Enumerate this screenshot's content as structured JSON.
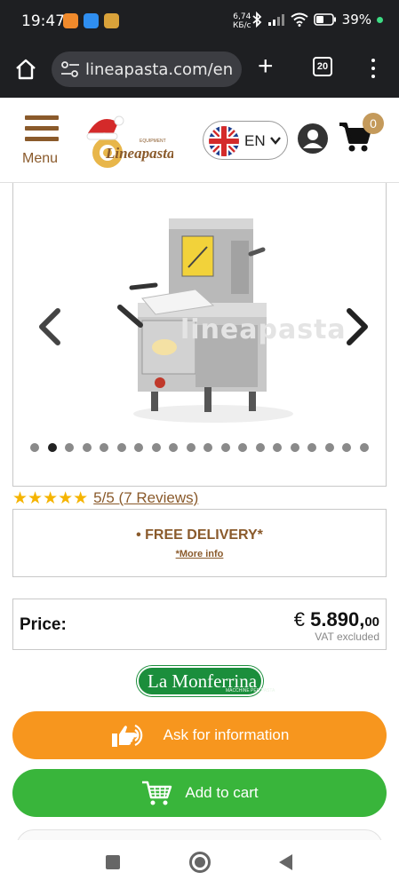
{
  "status_bar": {
    "time": "19:47",
    "speed_value": "6,74",
    "speed_unit": "КБ/с",
    "battery": "39%",
    "icons": [
      "notification-app-icon",
      "notification-app-icon",
      "notification-app-icon",
      "bluetooth-icon",
      "signal-icon",
      "wifi-icon",
      "battery-icon"
    ]
  },
  "browser": {
    "url": "lineapasta.com/en",
    "tab_count": "20"
  },
  "header": {
    "menu_label": "Menu",
    "logo_text": "Lineapasta",
    "logo_sub": "EQUIPMENT",
    "language_code": "EN",
    "cart_count": "0"
  },
  "gallery": {
    "watermark": "lineapasta",
    "dot_count": 20,
    "active_dot": 1
  },
  "rating": {
    "stars": "★★★★★",
    "text": "5/5 (7 Reviews)",
    "value": 5
  },
  "delivery": {
    "title": "• FREE DELIVERY*",
    "link": "*More info"
  },
  "price": {
    "label": "Price:",
    "currency": "€",
    "amount": "5.890,",
    "cents": "00",
    "note": "VAT excluded"
  },
  "brand": {
    "name": "La Monferrina",
    "tagline": "MACCHINE PER PASTA"
  },
  "buttons": {
    "ask_label": "Ask for information",
    "cart_label": "Add to cart"
  },
  "colors": {
    "brand_brown": "#8a5a2b",
    "ask_orange": "#f7961e",
    "cart_green": "#39b53b",
    "star_gold": "#f5b400"
  }
}
